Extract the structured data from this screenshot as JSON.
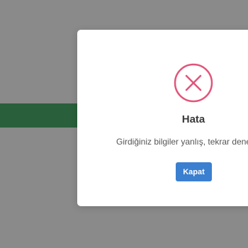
{
  "background": {
    "band_color": "#4caf6e"
  },
  "dialog": {
    "icon": "error-x-icon",
    "icon_color": "#e2547a",
    "title": "Hata",
    "message": "Girdiğiniz bilgiler yanlış, tekrar deneyin.",
    "close_label": "Kapat",
    "button_color": "#3a7fd0"
  }
}
